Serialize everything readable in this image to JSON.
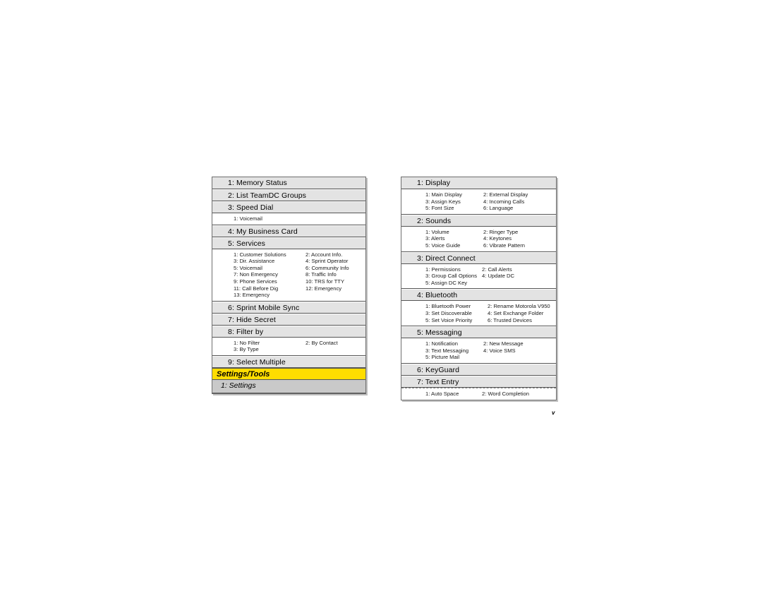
{
  "page": {
    "folio": "v"
  },
  "left_column": {
    "rows": [
      {
        "type": "header",
        "label": "1: Memory Status"
      },
      {
        "type": "header",
        "label": "2: List TeamDC Groups"
      },
      {
        "type": "header",
        "label": "3: Speed Dial"
      },
      {
        "type": "sub",
        "items": [
          "1: Voicemail"
        ]
      },
      {
        "type": "header",
        "label": "4: My Business Card"
      },
      {
        "type": "header",
        "label": "5: Services"
      },
      {
        "type": "sub",
        "items": [
          "1: Customer Solutions",
          "2: Account Info.",
          "3: Dir. Assistance",
          "4: Sprint Operator",
          "5: Voicemail",
          "6: Community Info",
          "7: Non Emergency",
          "8: Traffic Info",
          "9: Phone Services",
          "10: TRS for TTY",
          "11: Call Before Dig",
          "12: Emergency",
          "13: Emergency"
        ]
      },
      {
        "type": "header",
        "label": "6: Sprint Mobile Sync"
      },
      {
        "type": "header",
        "label": "7: Hide Secret"
      },
      {
        "type": "header",
        "label": "8: Filter by"
      },
      {
        "type": "sub",
        "items": [
          "1: No Filter",
          "2: By Contact",
          "3: By Type"
        ]
      },
      {
        "type": "header",
        "label": "9: Select Multiple"
      },
      {
        "type": "yellow",
        "label": "Settings/Tools"
      },
      {
        "type": "subheader",
        "label": "1: Settings"
      }
    ]
  },
  "right_column": {
    "rows": [
      {
        "type": "header",
        "label": "1: Display"
      },
      {
        "type": "sub",
        "items": [
          "1: Main Display",
          "2: External Display",
          "3: Assign Keys",
          "4: Incoming Calls",
          "5: Font Size",
          "6: Language"
        ]
      },
      {
        "type": "header",
        "label": "2: Sounds"
      },
      {
        "type": "sub",
        "items": [
          "1: Volume",
          "2: Ringer Type",
          "3: Alerts",
          "4: Keytones",
          "5: Voice Guide",
          "6: Vibrate Pattern"
        ]
      },
      {
        "type": "header",
        "label": "3: Direct Connect"
      },
      {
        "type": "sub",
        "items": [
          "1: Permissions",
          "2: Call Alerts",
          "3: Group Call Options",
          "4: Update DC",
          "5: Assign DC Key"
        ]
      },
      {
        "type": "header",
        "label": "4: Bluetooth"
      },
      {
        "type": "sub",
        "items": [
          "1: Bluetooth Power",
          "2: Rename Motorola V950",
          "3: Set Discoverable",
          "4: Set Exchange Folder",
          "5: Set Voice Priority",
          "6: Trusted Devices"
        ]
      },
      {
        "type": "header",
        "label": "5: Messaging"
      },
      {
        "type": "sub",
        "items": [
          "1: Notification",
          "2: New Message",
          "3: Text Messaging",
          "4: Voice SMS",
          "5: Picture Mail"
        ]
      },
      {
        "type": "header",
        "label": "6: KeyGuard"
      },
      {
        "type": "header",
        "label": "7: Text Entry"
      },
      {
        "type": "sub_dashed",
        "items": [
          "1: Auto Space",
          "2: Word Completion"
        ]
      }
    ]
  },
  "colors": {
    "header_bg": "#e3e3e3",
    "yellow_bg": "#ffdd00",
    "subheader_bg": "#c9c9c9",
    "border": "#555555",
    "text": "#000000"
  }
}
